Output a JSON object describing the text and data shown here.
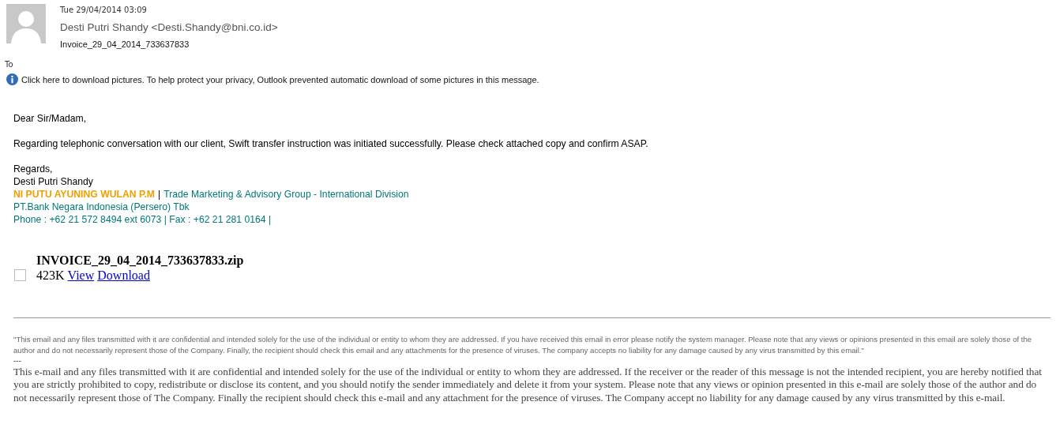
{
  "header": {
    "date": "Tue 29/04/2014 03:09",
    "sender": "Desti Putri Shandy <Desti.Shandy@bni.co.id>",
    "subject": "Invoice_29_04_2014_733637833",
    "to_label": "To"
  },
  "info_bar": {
    "text": "Click here to download pictures. To help protect your privacy, Outlook prevented automatic download of some pictures in this message."
  },
  "body": {
    "greeting": "Dear Sir/Madam,",
    "message": "Regarding telephonic conversation with our client, Swift transfer instruction was initiated successfully. Please check attached copy and confirm ASAP.",
    "closing": "Regards,",
    "signer": "Desti Putri Shandy"
  },
  "signature": {
    "name": "NI PUTU AYUNING WULAN P.M",
    "separator": "|",
    "division": "Trade Marketing & Advisory Group - International Division",
    "company": "PT.Bank Negara Indonesia (Persero) Tbk",
    "contact": "Phone : +62 21 572 8494 ext 6073 | Fax : +62 21 281 0164 |"
  },
  "attachment": {
    "filename": "INVOICE_29_04_2014_733637833.zip",
    "size": "423K",
    "links": [
      "View",
      "Download"
    ]
  },
  "disclaimers": [
    {
      "kind": "small",
      "text": "\"This email and any files transmitted with it are confidential and intended solely for the use of the individual or entity to whom they are addressed. If you have received this email in error please notify the system manager. Please note that any views or opinions presented in this email are solely those of the author and do not necessarily represent those of the Company. Finally, the recipient should check this email and any attachments for the presence of viruses. The company accepts no liability for any damage caused by any virus transmitted by this email.\""
    },
    {
      "kind": "separator",
      "text": "---"
    },
    {
      "kind": "serif",
      "text": "This e-mail and any files transmitted with it are confidential and intended solely for the use of the individual or entity to whom they are addressed. If the receiver or the reader of this message is not the intended recipient, you are hereby notified that you are strictly prohibited to copy, redistribute or disclose its content, and you should notify the sender immediately and delete it from your system. Please note that any views or opinion presented in this e-mail are solely those of the author and do not necessarily represent those of The Company. Finally the recipient should check this e-mail and any attachment for the presence of viruses. The Company accept no liability for any damage caused by any virus transmitted by this e-mail."
    }
  ]
}
